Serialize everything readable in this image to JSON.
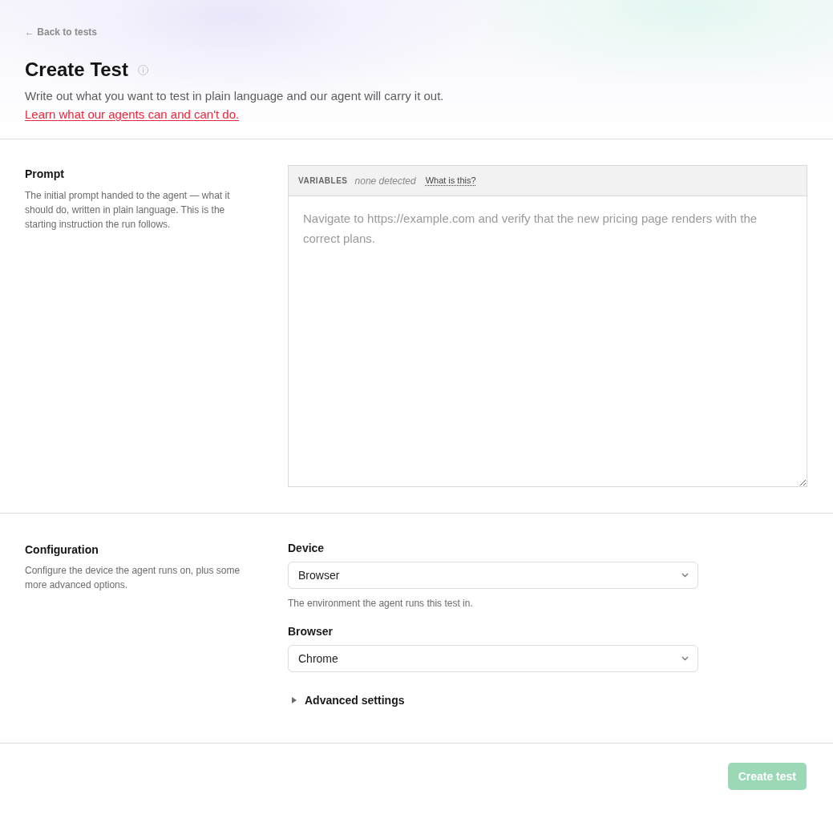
{
  "header": {
    "back_link": "← Back to tests",
    "title": "Create Test",
    "description": "Write out what you want to test in plain language and our agent will carry it out.",
    "help_link": "Learn what our agents can and can't do."
  },
  "prompt_section": {
    "title": "Prompt",
    "description": "The initial prompt handed to the agent — what it should do, written in plain language. This is the starting instruction the run follows.",
    "variables": {
      "label": "VARIABLES",
      "status": "none detected",
      "help_link": "What is this?"
    },
    "prompt_field": {
      "placeholder": "Navigate to https://example.com and verify that the new pricing page renders with the correct plans."
    }
  },
  "configuration_section": {
    "title": "Configuration",
    "description": "Configure the device the agent runs on, plus some more advanced options.",
    "fields": [
      {
        "label": "Device",
        "value": "Browser",
        "hint": "The environment the agent runs this test in."
      },
      {
        "label": "Browser",
        "value": "Chrome"
      }
    ],
    "advanced_settings": {
      "label": "Advanced settings",
      "expanded": false
    }
  },
  "footer": {
    "create_button": {
      "label": "Create test",
      "disabled": true
    }
  }
}
